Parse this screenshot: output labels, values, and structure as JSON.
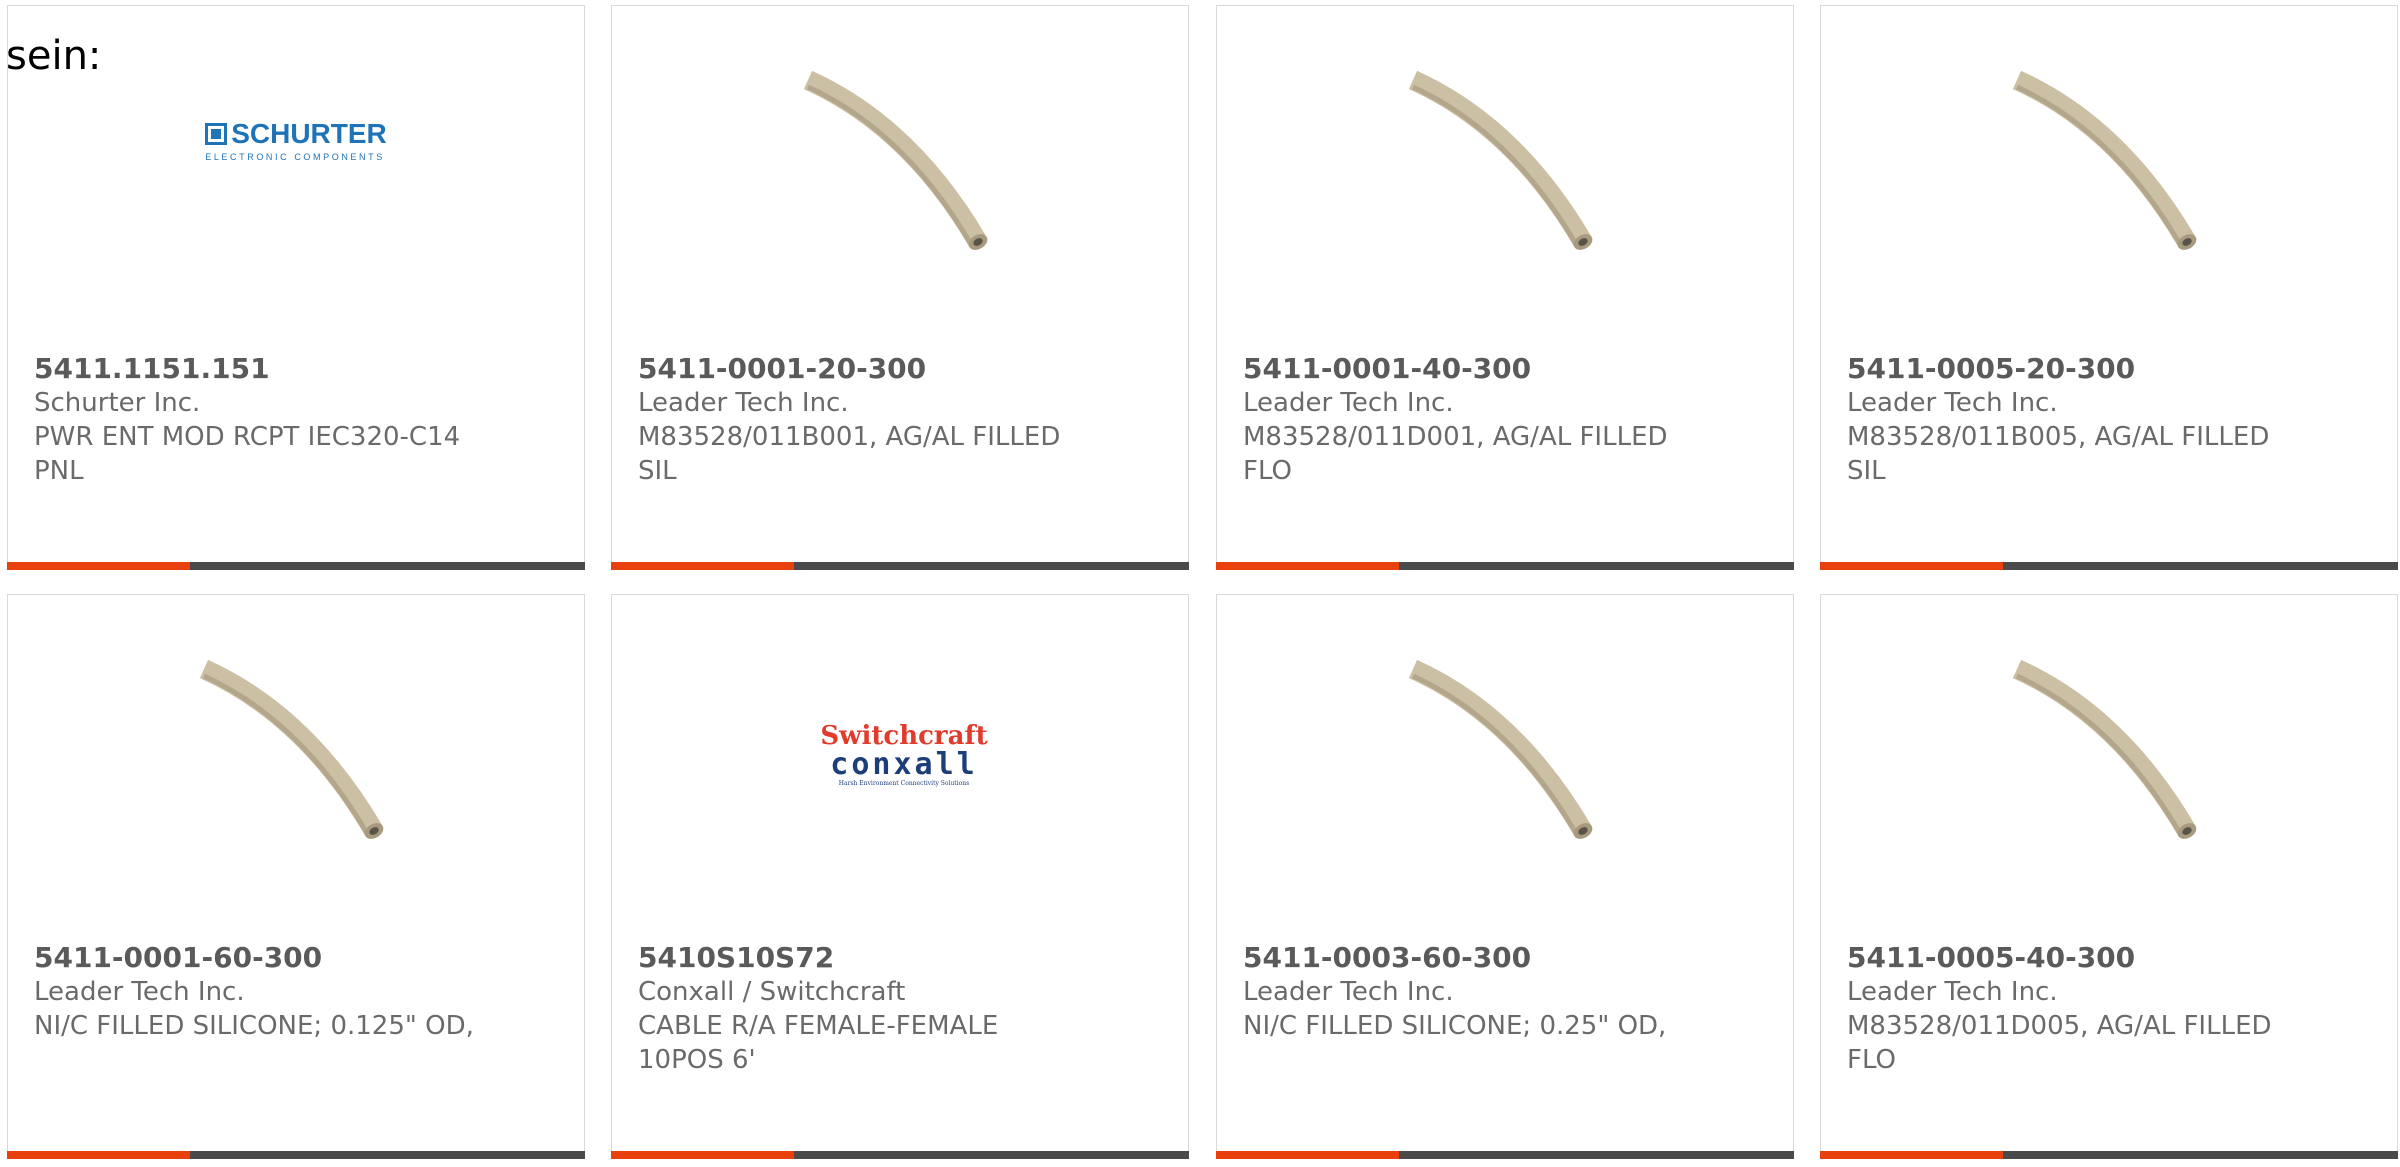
{
  "intro_text": "sein:",
  "colors": {
    "accent": "#e8410e",
    "bar": "#4a4a4a",
    "tube": "#cbbfa4"
  },
  "products": [
    {
      "part": "5411.1151.151",
      "manufacturer": "Schurter Inc.",
      "description": "PWR ENT MOD RCPT IEC320-C14 PNL",
      "image": "schurter-logo",
      "logo_text": "SCHURTER",
      "logo_sub": "ELECTRONIC COMPONENTS"
    },
    {
      "part": "5411-0001-20-300",
      "manufacturer": "Leader Tech Inc.",
      "description": "M83528/011B001, AG/AL FILLED SIL",
      "image": "tube-icon"
    },
    {
      "part": "5411-0001-40-300",
      "manufacturer": "Leader Tech Inc.",
      "description": "M83528/011D001, AG/AL FILLED FLO",
      "image": "tube-icon"
    },
    {
      "part": "5411-0005-20-300",
      "manufacturer": "Leader Tech Inc.",
      "description": "M83528/011B005, AG/AL FILLED SIL",
      "image": "tube-icon"
    },
    {
      "part": "5411-0001-60-300",
      "manufacturer": "Leader Tech Inc.",
      "description": "NI/C FILLED SILICONE; 0.125\" OD,",
      "image": "tube-icon"
    },
    {
      "part": "5410S10S72",
      "manufacturer": "Conxall / Switchcraft",
      "description": "CABLE R/A FEMALE-FEMALE 10POS 6'",
      "image": "switchcraft-logo",
      "logo_text": "Switchcraft",
      "logo_sub": "conxall",
      "logo_tag": "Harsh Environment Connectivity Solutions"
    },
    {
      "part": "5411-0003-60-300",
      "manufacturer": "Leader Tech Inc.",
      "description": "NI/C FILLED SILICONE; 0.25\" OD,",
      "image": "tube-icon"
    },
    {
      "part": "5411-0005-40-300",
      "manufacturer": "Leader Tech Inc.",
      "description": "M83528/011D005, AG/AL FILLED FLO",
      "image": "tube-icon"
    }
  ]
}
